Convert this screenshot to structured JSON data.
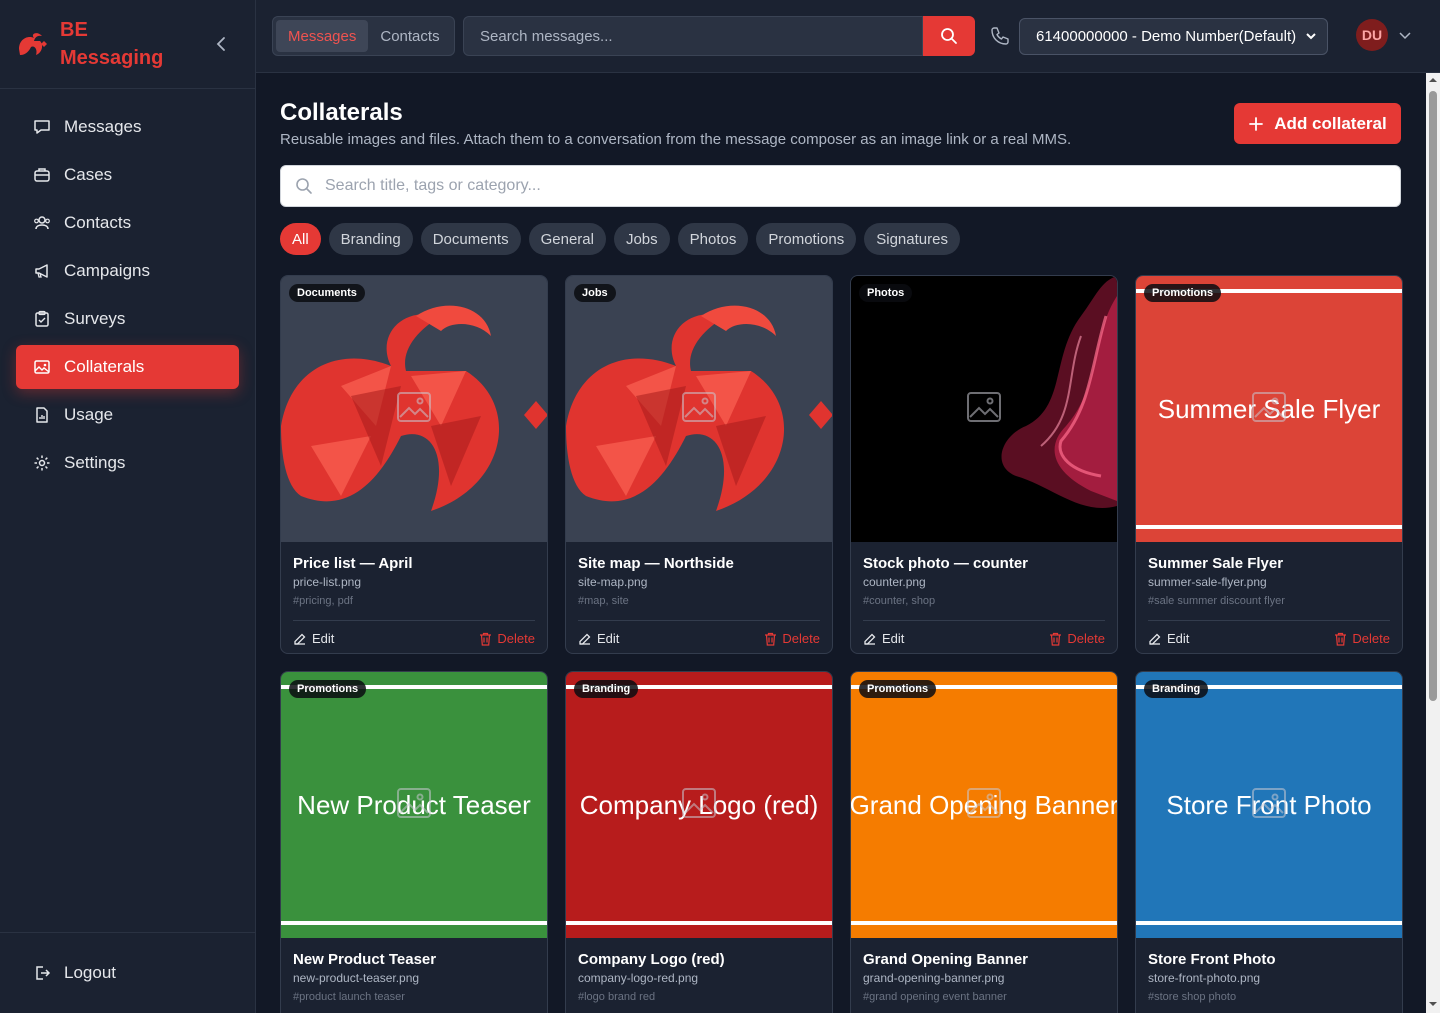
{
  "app": {
    "title": "BE Messaging",
    "brand_line1": "BE",
    "brand_line2": "Messaging"
  },
  "sidebar": {
    "items": [
      {
        "label": "Messages",
        "icon": "chat-icon"
      },
      {
        "label": "Cases",
        "icon": "briefcase-icon"
      },
      {
        "label": "Contacts",
        "icon": "users-icon"
      },
      {
        "label": "Campaigns",
        "icon": "megaphone-icon"
      },
      {
        "label": "Surveys",
        "icon": "clipboard-icon"
      },
      {
        "label": "Collaterals",
        "icon": "image-icon",
        "active": true
      },
      {
        "label": "Usage",
        "icon": "file-chart-icon"
      },
      {
        "label": "Settings",
        "icon": "gear-icon"
      }
    ],
    "logout": "Logout"
  },
  "topbar": {
    "tabs": [
      "Messages",
      "Contacts"
    ],
    "active_tab": "Messages",
    "search_placeholder": "Search messages...",
    "number": "61400000000 - Demo Number(Default)",
    "avatar": "DU"
  },
  "page": {
    "title": "Collaterals",
    "subtitle": "Reusable images and files. Attach them to a conversation from the message composer as an image link or a real MMS.",
    "add_button": "Add collateral",
    "search_placeholder": "Search title, tags or category...",
    "filters": [
      "All",
      "Branding",
      "Documents",
      "General",
      "Jobs",
      "Photos",
      "Promotions",
      "Signatures"
    ],
    "active_filter": "All"
  },
  "actions": {
    "edit": "Edit",
    "delete": "Delete"
  },
  "cards": [
    {
      "category": "Documents",
      "title": "Price list — April",
      "file": "price-list.png",
      "tags": "#pricing, pdf",
      "thumb": "logo"
    },
    {
      "category": "Jobs",
      "title": "Site map — Northside",
      "file": "site-map.png",
      "tags": "#map, site",
      "thumb": "logo"
    },
    {
      "category": "Photos",
      "title": "Stock photo — counter",
      "file": "counter.png",
      "tags": "#counter, shop",
      "thumb": "photo"
    },
    {
      "category": "Promotions",
      "title": "Summer Sale Flyer",
      "file": "summer-sale-flyer.png",
      "tags": "#sale summer discount flyer",
      "thumb": "banner",
      "banner_text": "Summer Sale Flyer",
      "color": "#dc4437"
    },
    {
      "category": "Promotions",
      "title": "New Product Teaser",
      "file": "new-product-teaser.png",
      "tags": "#product launch teaser",
      "thumb": "banner",
      "banner_text": "New Product Teaser",
      "color": "#3a913d"
    },
    {
      "category": "Branding",
      "title": "Company Logo (red)",
      "file": "company-logo-red.png",
      "tags": "#logo brand red",
      "thumb": "banner",
      "banner_text": "Company Logo (red)",
      "color": "#b71c1c"
    },
    {
      "category": "Promotions",
      "title": "Grand Opening Banner",
      "file": "grand-opening-banner.png",
      "tags": "#grand opening event banner",
      "thumb": "banner",
      "banner_text": "Grand Opening Banner",
      "color": "#f57c00"
    },
    {
      "category": "Branding",
      "title": "Store Front Photo",
      "file": "store-front-photo.png",
      "tags": "#store shop photo",
      "thumb": "banner",
      "banner_text": "Store Front Photo",
      "color": "#2176b8"
    }
  ],
  "colors": {
    "accent": "#e53935",
    "sidebar_bg": "#1b2231",
    "page_bg": "#121826"
  }
}
